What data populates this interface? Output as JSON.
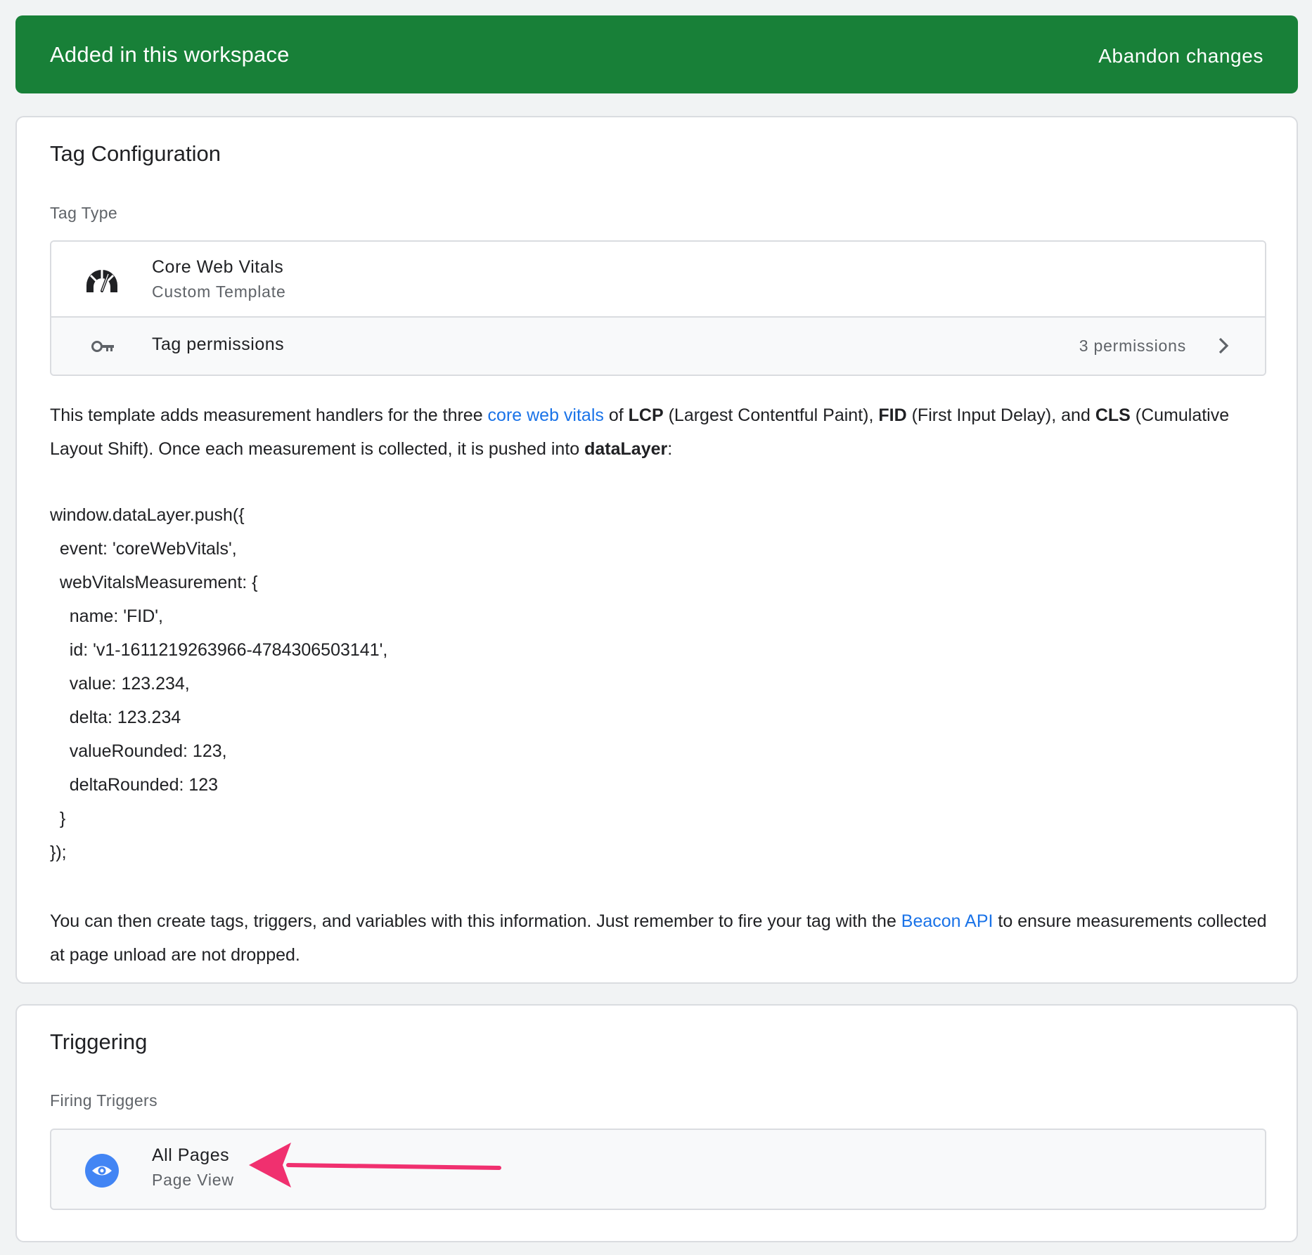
{
  "banner": {
    "title": "Added in this workspace",
    "abandon_label": "Abandon changes",
    "color": "#188038"
  },
  "tag_configuration": {
    "title": "Tag Configuration",
    "tag_type_label": "Tag Type",
    "tag_type": {
      "name": "Core Web Vitals",
      "subtitle": "Custom Template",
      "icon": "gauge-icon"
    },
    "permissions": {
      "label": "Tag permissions",
      "count": "3 permissions",
      "icon": "key-icon"
    },
    "description": {
      "p1_a": "This template adds measurement handlers for the three ",
      "p1_link": "core web vitals",
      "p1_b": " of ",
      "p1_lcp": "LCP",
      "p1_c": " (Largest Contentful Paint), ",
      "p1_fid": "FID",
      "p1_d": " (First Input Delay), and ",
      "p1_cls": "CLS",
      "p1_e": " (Cumulative Layout Shift). Once each measurement is collected, it is pushed into ",
      "p1_dl": "dataLayer",
      "p1_f": ":",
      "p2_a": "You can then create tags, triggers, and variables with this information. Just remember to fire your tag with the ",
      "p2_link": "Beacon API",
      "p2_b": " to ensure measurements collected at page unload are not dropped."
    },
    "code_lines": [
      "window.dataLayer.push({",
      "  event: 'coreWebVitals',",
      "  webVitalsMeasurement: {",
      "    name: 'FID',",
      "    id: 'v1-1611219263966-4784306503141',",
      "    value: 123.234,",
      "    delta: 123.234",
      "    valueRounded: 123,",
      "    deltaRounded: 123",
      "  }",
      "});"
    ],
    "link_color": "#1a73e8"
  },
  "triggering": {
    "title": "Triggering",
    "firing_label": "Firing Triggers",
    "trigger": {
      "name": "All Pages",
      "subtitle": "Page View",
      "icon": "eye-icon",
      "icon_color": "#4285f4"
    },
    "annotation_arrow_color": "#f0306f"
  }
}
